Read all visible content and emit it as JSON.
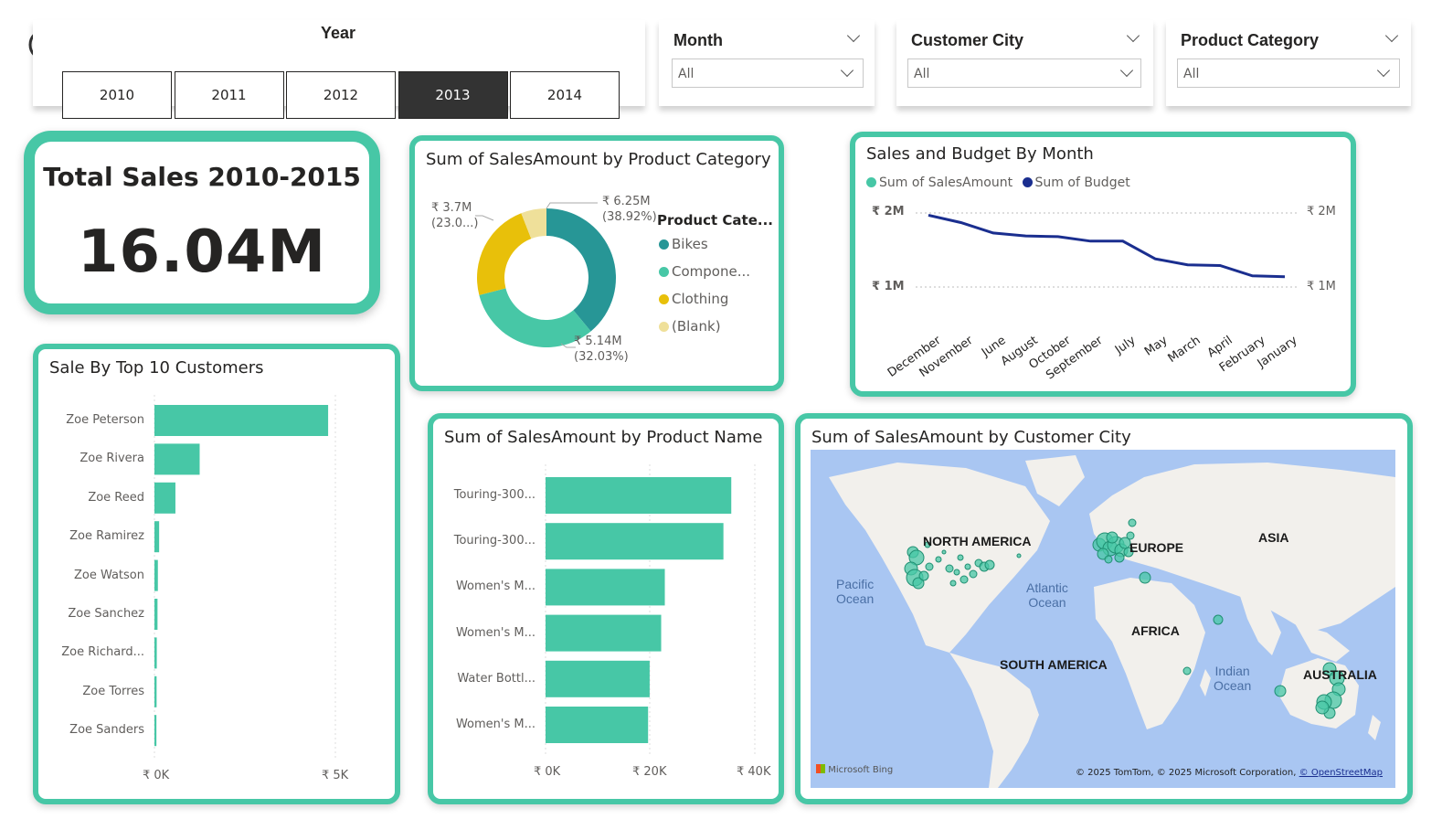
{
  "colors": {
    "teal": "#47c7a6",
    "teal_dark": "#279696",
    "gold": "#e8c00a",
    "blank": "#efe09a",
    "navy": "#1a2e8f",
    "ocean": "#a9c6f2",
    "land": "#f2f0ec"
  },
  "back_button": {
    "icon": "back-arrow-icon"
  },
  "year_slicer": {
    "title": "Year",
    "years": [
      "2010",
      "2011",
      "2012",
      "2013",
      "2014"
    ],
    "selected": "2013"
  },
  "month_slicer": {
    "title": "Month",
    "value": "All"
  },
  "city_slicer": {
    "title": "Customer City",
    "value": "All"
  },
  "category_slicer": {
    "title": "Product Category",
    "value": "All"
  },
  "kpi": {
    "title": "Total Sales 2010-2015",
    "value": "16.04M"
  },
  "donut": {
    "title": "Sum of SalesAmount by Product Category",
    "legend_title": "Product Cate...",
    "label_bikes": "₹ 6.25M",
    "label_bikes_pct": "(38.92%)",
    "label_comp": "₹ 5.14M",
    "label_comp_pct": "(32.03%)",
    "label_cloth": "₹ 3.7M",
    "label_cloth_pct": "(23.0...)"
  },
  "line": {
    "title": "Sales and Budget By Month",
    "legend_sales": "Sum of SalesAmount",
    "legend_budget": "Sum of Budget",
    "y_2m": "₹ 2M",
    "y_1m": "₹ 1M"
  },
  "customers": {
    "title": "Sale By Top 10 Customers",
    "x0": "₹ 0K",
    "x1": "₹ 5K"
  },
  "products": {
    "title": "Sum of SalesAmount by Product Name",
    "x0": "₹ 0K",
    "x1": "₹ 20K",
    "x2": "₹ 40K"
  },
  "map": {
    "title": "Sum of SalesAmount by Customer City",
    "north_america": "NORTH AMERICA",
    "europe": "EUROPE",
    "asia": "ASIA",
    "africa": "AFRICA",
    "south_america": "SOUTH AMERICA",
    "australia": "AUSTRALIA",
    "pacific": "Pacific\nOcean",
    "atlantic": "Atlantic\nOcean",
    "indian": "Indian\nOcean",
    "bing": "Microsoft Bing",
    "credits": "© 2025 TomTom, © 2025 Microsoft Corporation,",
    "osm": "© OpenStreetMap"
  },
  "chart_data": [
    {
      "type": "pie",
      "title": "Sum of SalesAmount by Product Category",
      "legend_title": "Product Cate...",
      "categories": [
        "Bikes",
        "Compone...",
        "Clothing",
        "(Blank)"
      ],
      "values": [
        6.25,
        5.14,
        3.7,
        0.95
      ],
      "percent": [
        38.92,
        32.03,
        23.0,
        6.05
      ],
      "unit": "₹ M",
      "colors": [
        "#279696",
        "#47c7a6",
        "#e8c00a",
        "#efe09a"
      ]
    },
    {
      "type": "line",
      "title": "Sales and Budget By Month",
      "categories": [
        "December",
        "November",
        "June",
        "August",
        "October",
        "September",
        "July",
        "May",
        "March",
        "April",
        "February",
        "January"
      ],
      "series": [
        {
          "name": "Sum of SalesAmount",
          "values": [],
          "color": "#47c7a6"
        },
        {
          "name": "Sum of Budget",
          "values": [
            1.97,
            1.87,
            1.73,
            1.69,
            1.68,
            1.62,
            1.62,
            1.38,
            1.3,
            1.29,
            1.15,
            1.14
          ],
          "color": "#1a2e8f"
        }
      ],
      "ylim": [
        0.9,
        2.05
      ],
      "yticks": [
        "₹ 2M",
        "₹ 1M"
      ]
    },
    {
      "type": "bar",
      "title": "Sale By Top 10 Customers",
      "categories": [
        "Zoe Peterson",
        "Zoe Rivera",
        "Zoe Reed",
        "Zoe Ramirez",
        "Zoe Watson",
        "Zoe Sanchez",
        "Zoe Richard...",
        "Zoe Torres",
        "Zoe Sanders"
      ],
      "values": [
        4800,
        1250,
        580,
        130,
        95,
        85,
        65,
        60,
        55
      ],
      "xlim": [
        0,
        5000
      ],
      "xticks": [
        "₹ 0K",
        "₹ 5K"
      ]
    },
    {
      "type": "bar",
      "title": "Sum of SalesAmount by Product Name",
      "categories": [
        "Touring-300...",
        "Touring-300...",
        "Women's M...",
        "Women's M...",
        "Water Bottl...",
        "Women's M..."
      ],
      "values": [
        35500,
        34000,
        22800,
        22100,
        19900,
        19600
      ],
      "xlim": [
        0,
        40000
      ],
      "xticks": [
        "₹ 0K",
        "₹ 20K",
        "₹ 40K"
      ]
    }
  ]
}
